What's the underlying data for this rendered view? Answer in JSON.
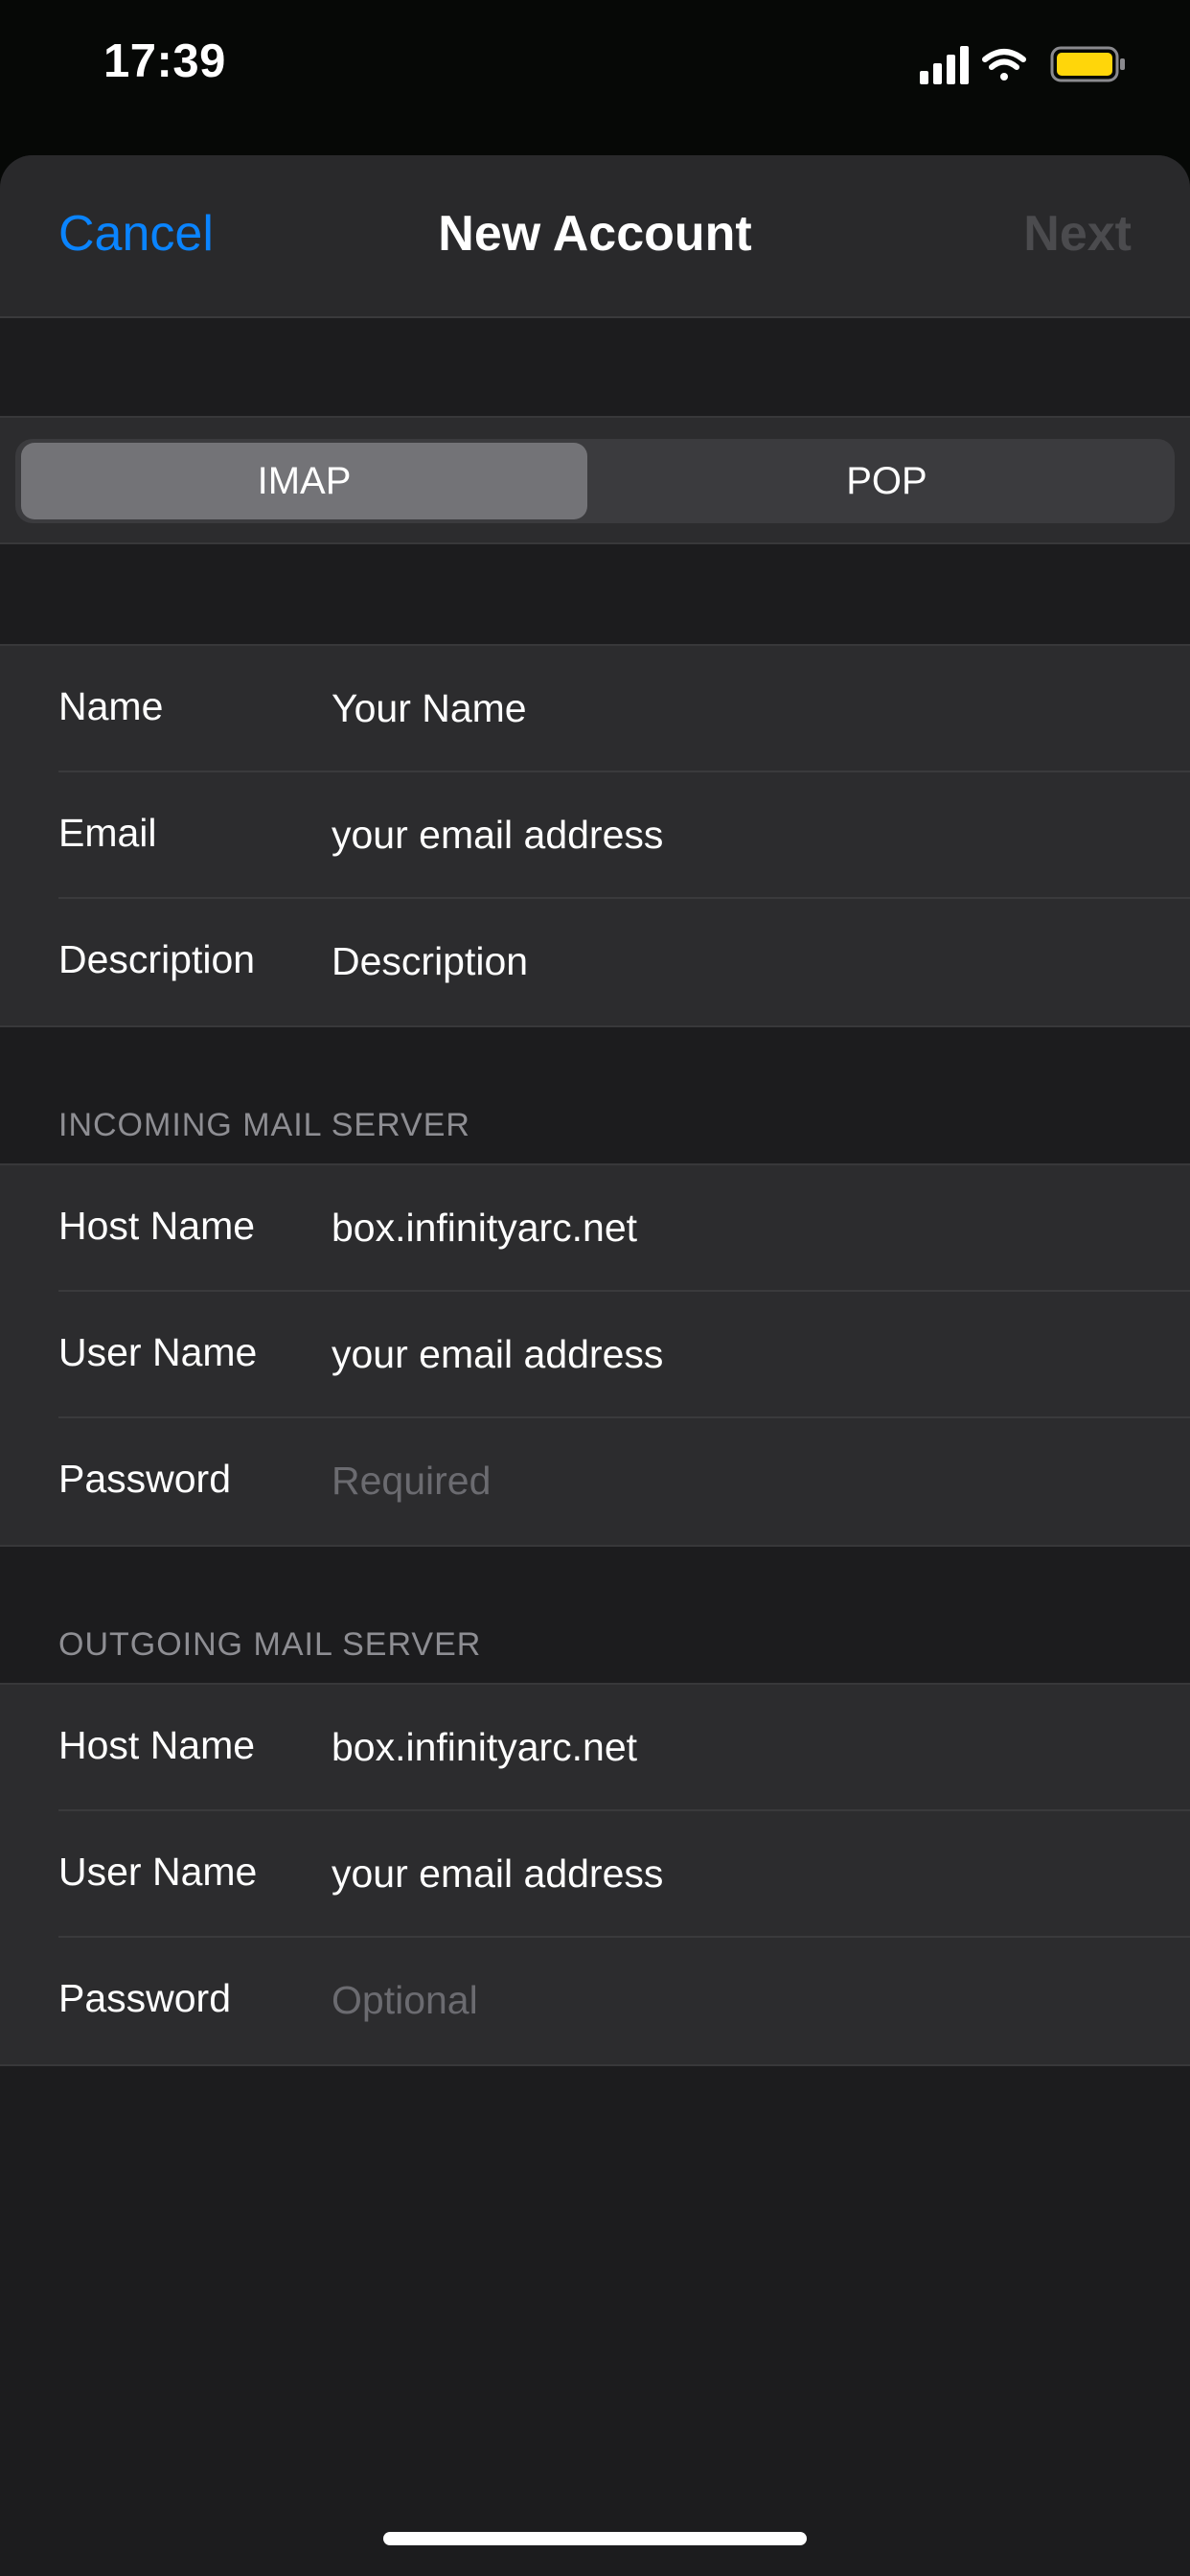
{
  "status_bar": {
    "time": "17:39",
    "icons": [
      "cellular-signal-icon",
      "wifi-icon",
      "battery-icon"
    ],
    "battery_color": "#ffd60a"
  },
  "nav": {
    "cancel_label": "Cancel",
    "title": "New Account",
    "next_label": "Next"
  },
  "account_type": {
    "options": [
      "IMAP",
      "POP"
    ],
    "selected": "IMAP"
  },
  "account_info": [
    {
      "label": "Name",
      "value": "Your Name",
      "placeholder": false
    },
    {
      "label": "Email",
      "value": "your email address",
      "placeholder": false
    },
    {
      "label": "Description",
      "value": "Description",
      "placeholder": false
    }
  ],
  "incoming": {
    "header": "INCOMING MAIL SERVER",
    "rows": [
      {
        "label": "Host Name",
        "value": "box.infinityarc.net",
        "placeholder": false
      },
      {
        "label": "User Name",
        "value": "your email address",
        "placeholder": false
      },
      {
        "label": "Password",
        "value": "Required",
        "placeholder": true
      }
    ]
  },
  "outgoing": {
    "header": "OUTGOING MAIL SERVER",
    "rows": [
      {
        "label": "Host Name",
        "value": "box.infinityarc.net",
        "placeholder": false
      },
      {
        "label": "User Name",
        "value": "your email address",
        "placeholder": false
      },
      {
        "label": "Password",
        "value": "Optional",
        "placeholder": true
      }
    ]
  },
  "colors": {
    "accent": "#0a84ff",
    "disabled": "#4b4b4e",
    "background": "#1c1c1e",
    "cell": "#2c2c2e"
  }
}
